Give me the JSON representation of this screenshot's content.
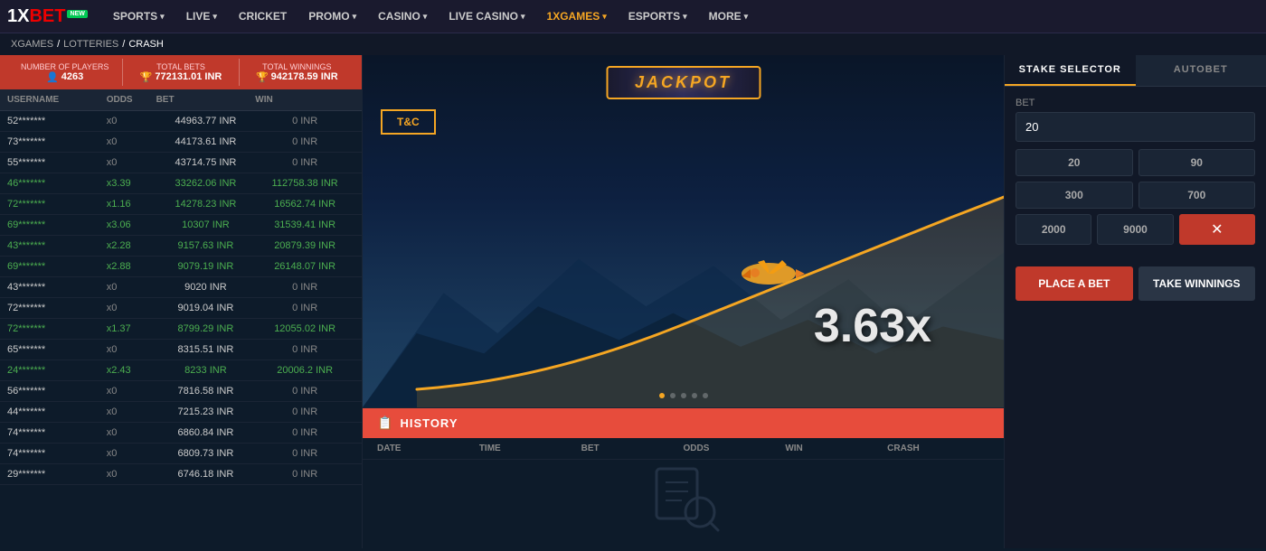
{
  "nav": {
    "logo": "1XBET",
    "logo_new": "NEW",
    "items": [
      {
        "label": "SPORTS",
        "has_arrow": true,
        "active": false
      },
      {
        "label": "LIVE",
        "has_arrow": true,
        "active": false
      },
      {
        "label": "CRICKET",
        "has_arrow": false,
        "active": false
      },
      {
        "label": "PROMO",
        "has_arrow": true,
        "active": false
      },
      {
        "label": "CASINO",
        "has_arrow": true,
        "active": false
      },
      {
        "label": "LIVE CASINO",
        "has_arrow": true,
        "active": false
      },
      {
        "label": "1XGAMES",
        "has_arrow": true,
        "active": true
      },
      {
        "label": "ESPORTS",
        "has_arrow": true,
        "active": false
      },
      {
        "label": "MORE",
        "has_arrow": true,
        "active": false
      }
    ]
  },
  "breadcrumb": {
    "items": [
      "XGAMES",
      "LOTTERIES",
      "CRASH"
    ]
  },
  "stats": {
    "players_label": "Number of players",
    "players_value": "4263",
    "bets_label": "Total bets",
    "bets_value": "772131.01 INR",
    "winnings_label": "Total winnings",
    "winnings_value": "942178.59 INR"
  },
  "table": {
    "headers": [
      "USERNAME",
      "ODDS",
      "BET",
      "WIN"
    ],
    "rows": [
      {
        "user": "52*******",
        "odds": "x0",
        "bet": "44963.77 INR",
        "win": "0 INR",
        "winner": false
      },
      {
        "user": "73*******",
        "odds": "x0",
        "bet": "44173.61 INR",
        "win": "0 INR",
        "winner": false
      },
      {
        "user": "55*******",
        "odds": "x0",
        "bet": "43714.75 INR",
        "win": "0 INR",
        "winner": false
      },
      {
        "user": "46*******",
        "odds": "x3.39",
        "bet": "33262.06 INR",
        "win": "112758.38 INR",
        "winner": true
      },
      {
        "user": "72*******",
        "odds": "x1.16",
        "bet": "14278.23 INR",
        "win": "16562.74 INR",
        "winner": true
      },
      {
        "user": "69*******",
        "odds": "x3.06",
        "bet": "10307 INR",
        "win": "31539.41 INR",
        "winner": true
      },
      {
        "user": "43*******",
        "odds": "x2.28",
        "bet": "9157.63 INR",
        "win": "20879.39 INR",
        "winner": true
      },
      {
        "user": "69*******",
        "odds": "x2.88",
        "bet": "9079.19 INR",
        "win": "26148.07 INR",
        "winner": true
      },
      {
        "user": "43*******",
        "odds": "x0",
        "bet": "9020 INR",
        "win": "0 INR",
        "winner": false
      },
      {
        "user": "72*******",
        "odds": "x0",
        "bet": "9019.04 INR",
        "win": "0 INR",
        "winner": false
      },
      {
        "user": "72*******",
        "odds": "x1.37",
        "bet": "8799.29 INR",
        "win": "12055.02 INR",
        "winner": true
      },
      {
        "user": "65*******",
        "odds": "x0",
        "bet": "8315.51 INR",
        "win": "0 INR",
        "winner": false
      },
      {
        "user": "24*******",
        "odds": "x2.43",
        "bet": "8233 INR",
        "win": "20006.2 INR",
        "winner": true
      },
      {
        "user": "56*******",
        "odds": "x0",
        "bet": "7816.58 INR",
        "win": "0 INR",
        "winner": false
      },
      {
        "user": "44*******",
        "odds": "x0",
        "bet": "7215.23 INR",
        "win": "0 INR",
        "winner": false
      },
      {
        "user": "74*******",
        "odds": "x0",
        "bet": "6860.84 INR",
        "win": "0 INR",
        "winner": false
      },
      {
        "user": "74*******",
        "odds": "x0",
        "bet": "6809.73 INR",
        "win": "0 INR",
        "winner": false
      },
      {
        "user": "29*******",
        "odds": "x0",
        "bet": "6746.18 INR",
        "win": "0 INR",
        "winner": false
      }
    ]
  },
  "game": {
    "jackpot_text": "JACKPOT",
    "tc_label": "T&C",
    "multiplier": "3.63x"
  },
  "history": {
    "title": "HISTORY",
    "headers": [
      "DATE",
      "TIME",
      "BET",
      "ODDS",
      "WIN",
      "CRASH"
    ]
  },
  "stake": {
    "selector_label": "STAKE SELECTOR",
    "autobet_label": "AUTOBET",
    "bet_label": "Bet",
    "bet_value": "20",
    "quick_bets": [
      "20",
      "90",
      "300",
      "700"
    ],
    "quick_bets_2": [
      "2000",
      "9000"
    ],
    "place_bet_label": "PLACE A BET",
    "take_winnings_label": "TAKE WINNINGS"
  }
}
